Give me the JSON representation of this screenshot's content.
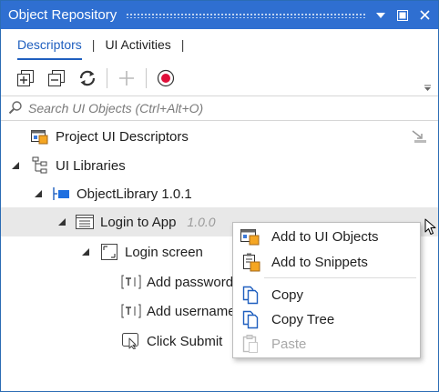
{
  "window": {
    "title": "Object Repository"
  },
  "tabs": [
    {
      "label": "Descriptors",
      "active": true
    },
    {
      "label": "UI Activities",
      "active": false
    }
  ],
  "toolbar": {
    "tools": [
      {
        "name": "expand-all",
        "icon": "expand-all-icon",
        "enabled": true
      },
      {
        "name": "collapse-all",
        "icon": "collapse-all-icon",
        "enabled": true
      },
      {
        "name": "refresh",
        "icon": "refresh-icon",
        "enabled": true
      },
      {
        "name": "add",
        "icon": "plus-icon",
        "enabled": false
      },
      {
        "name": "record",
        "icon": "record-icon",
        "enabled": true
      }
    ]
  },
  "search": {
    "placeholder": "Search UI Objects (Ctrl+Alt+O)"
  },
  "tree": {
    "project_descriptors": "Project UI Descriptors",
    "ui_libraries": "UI Libraries",
    "library": "ObjectLibrary 1.0.1",
    "app": {
      "name": "Login to App",
      "version": "1.0.0"
    },
    "screen": "Login screen",
    "elements": [
      {
        "label": "Add password",
        "type": "text-element-icon"
      },
      {
        "label": "Add username",
        "type": "text-element-icon"
      },
      {
        "label": "Click Submit",
        "type": "click-element-icon"
      }
    ]
  },
  "context_menu": {
    "items": [
      {
        "label": "Add to UI Objects",
        "icon": "add-to-ui-objects-icon",
        "enabled": true
      },
      {
        "label": "Add to Snippets",
        "icon": "add-to-snippets-icon",
        "enabled": true
      },
      {
        "label": "Copy",
        "icon": "copy-icon",
        "enabled": true
      },
      {
        "label": "Copy Tree",
        "icon": "copy-tree-icon",
        "enabled": true
      },
      {
        "label": "Paste",
        "icon": "paste-icon",
        "enabled": false
      }
    ]
  },
  "colors": {
    "titlebar": "#2f6fd1",
    "accent": "#1f5fbf",
    "record": "#e0103a",
    "selected_row": "#e8e8e8"
  }
}
